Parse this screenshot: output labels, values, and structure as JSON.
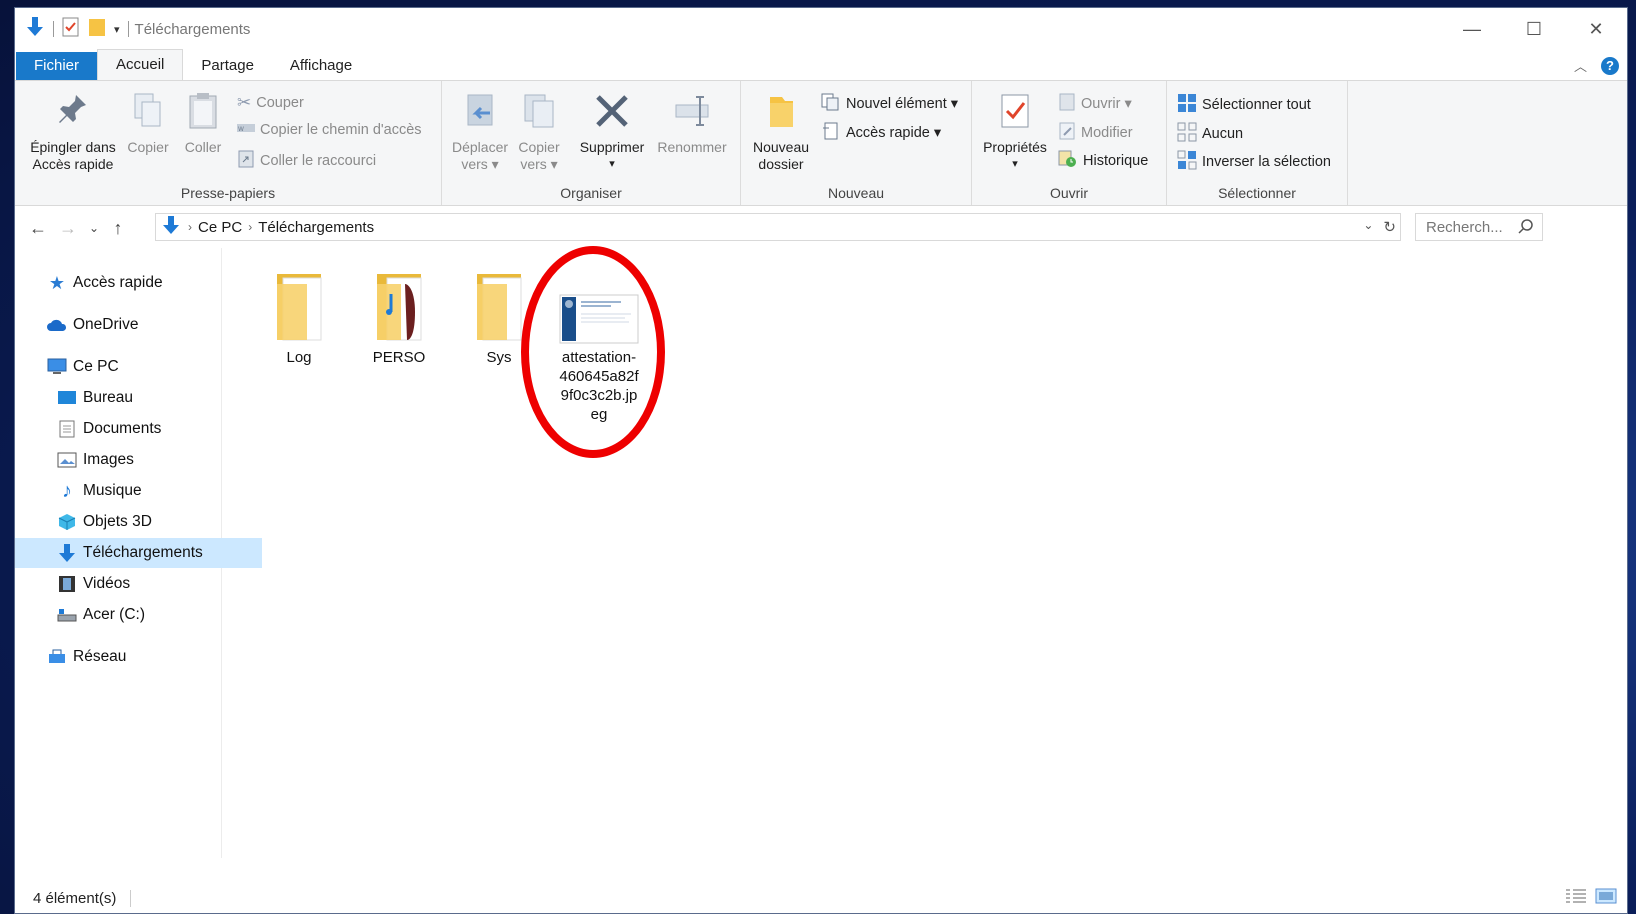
{
  "window": {
    "title": "Téléchargements",
    "controls": {
      "minimize": "—",
      "maximize": "☐",
      "close": "✕"
    }
  },
  "tabs": [
    {
      "label": "Fichier"
    },
    {
      "label": "Accueil"
    },
    {
      "label": "Partage"
    },
    {
      "label": "Affichage"
    }
  ],
  "ribbon": {
    "clipboard": {
      "label": "Presse-papiers",
      "pin_line1": "Épingler dans",
      "pin_line2": "Accès rapide",
      "copy": "Copier",
      "paste": "Coller",
      "cut": "Couper",
      "copy_path": "Copier le chemin d'accès",
      "paste_shortcut": "Coller le raccourci"
    },
    "organize": {
      "label": "Organiser",
      "move_line1": "Déplacer",
      "move_line2": "vers ▾",
      "copyto_line1": "Copier",
      "copyto_line2": "vers ▾",
      "delete": "Supprimer",
      "rename": "Renommer"
    },
    "new": {
      "label": "Nouveau",
      "folder_line1": "Nouveau",
      "folder_line2": "dossier",
      "new_item": "Nouvel élément ▾",
      "easy_access": "Accès rapide ▾"
    },
    "open": {
      "label": "Ouvrir",
      "properties": "Propriétés",
      "open": "Ouvrir ▾",
      "edit": "Modifier",
      "history": "Historique"
    },
    "select": {
      "label": "Sélectionner",
      "select_all": "Sélectionner tout",
      "select_none": "Aucun",
      "invert": "Inverser la sélection"
    }
  },
  "address": {
    "crumbs": [
      "Ce PC",
      "Téléchargements"
    ],
    "search_placeholder": "Recherch..."
  },
  "nav": {
    "quick_access": "Accès rapide",
    "onedrive": "OneDrive",
    "this_pc": "Ce PC",
    "desktop": "Bureau",
    "documents": "Documents",
    "pictures": "Images",
    "music": "Musique",
    "objects3d": "Objets 3D",
    "downloads": "Téléchargements",
    "videos": "Vidéos",
    "drive_c": "Acer (C:)",
    "network": "Réseau"
  },
  "files": [
    {
      "name": "Log",
      "type": "folder"
    },
    {
      "name": "PERSO",
      "type": "folder"
    },
    {
      "name": "Sys",
      "type": "folder"
    },
    {
      "name": "attestation-460645a82f9f0c3c2b.jpeg",
      "type": "image",
      "lines": [
        "attestation-",
        "460645a82f",
        "9f0c3c2b.jp",
        "eg"
      ]
    }
  ],
  "status": {
    "count": "4 élément(s)"
  },
  "colors": {
    "accent": "#1979ca",
    "selection": "#cce8ff",
    "highlight_circle": "#ee0000"
  }
}
